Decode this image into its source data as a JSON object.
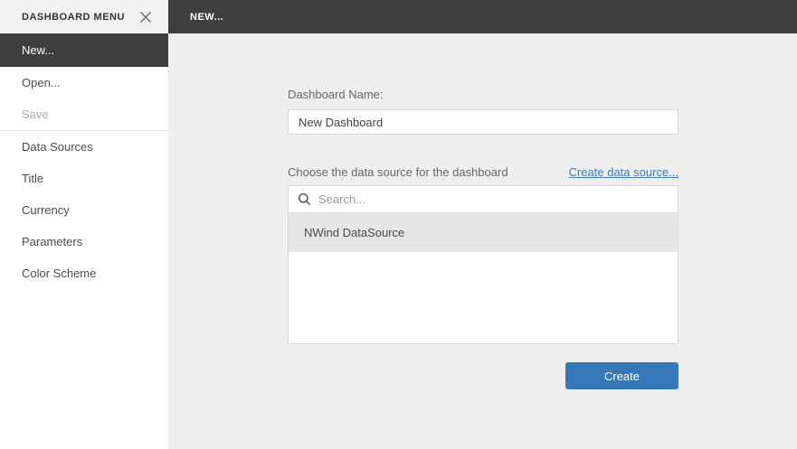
{
  "colors": {
    "dark_bar": "#3f3f3f",
    "sidebar_header_bg": "#f1f1f1",
    "main_bg": "#efefef",
    "selected_row_bg": "#e6e6e6",
    "accent_button": "#3579b8",
    "link": "#3b7bbf"
  },
  "sidebar": {
    "header": {
      "title": "DASHBOARD MENU"
    },
    "items": [
      {
        "label": "New...",
        "state": "active"
      },
      {
        "label": "Open...",
        "state": "normal"
      },
      {
        "label": "Save",
        "state": "disabled"
      },
      {
        "label": "Data Sources",
        "state": "normal"
      },
      {
        "label": "Title",
        "state": "normal"
      },
      {
        "label": "Currency",
        "state": "normal"
      },
      {
        "label": "Parameters",
        "state": "normal"
      },
      {
        "label": "Color Scheme",
        "state": "normal"
      }
    ]
  },
  "topbar": {
    "title": "NEW..."
  },
  "form": {
    "name_label": "Dashboard Name:",
    "name_value": "New Dashboard",
    "choose_label": "Choose the data source for the dashboard",
    "create_link": "Create data source...",
    "search_placeholder": "Search...",
    "datasources": [
      {
        "name": "NWind DataSource",
        "selected": true
      }
    ],
    "create_button": "Create"
  },
  "icons": {
    "close": "close-icon",
    "search": "search-icon"
  }
}
